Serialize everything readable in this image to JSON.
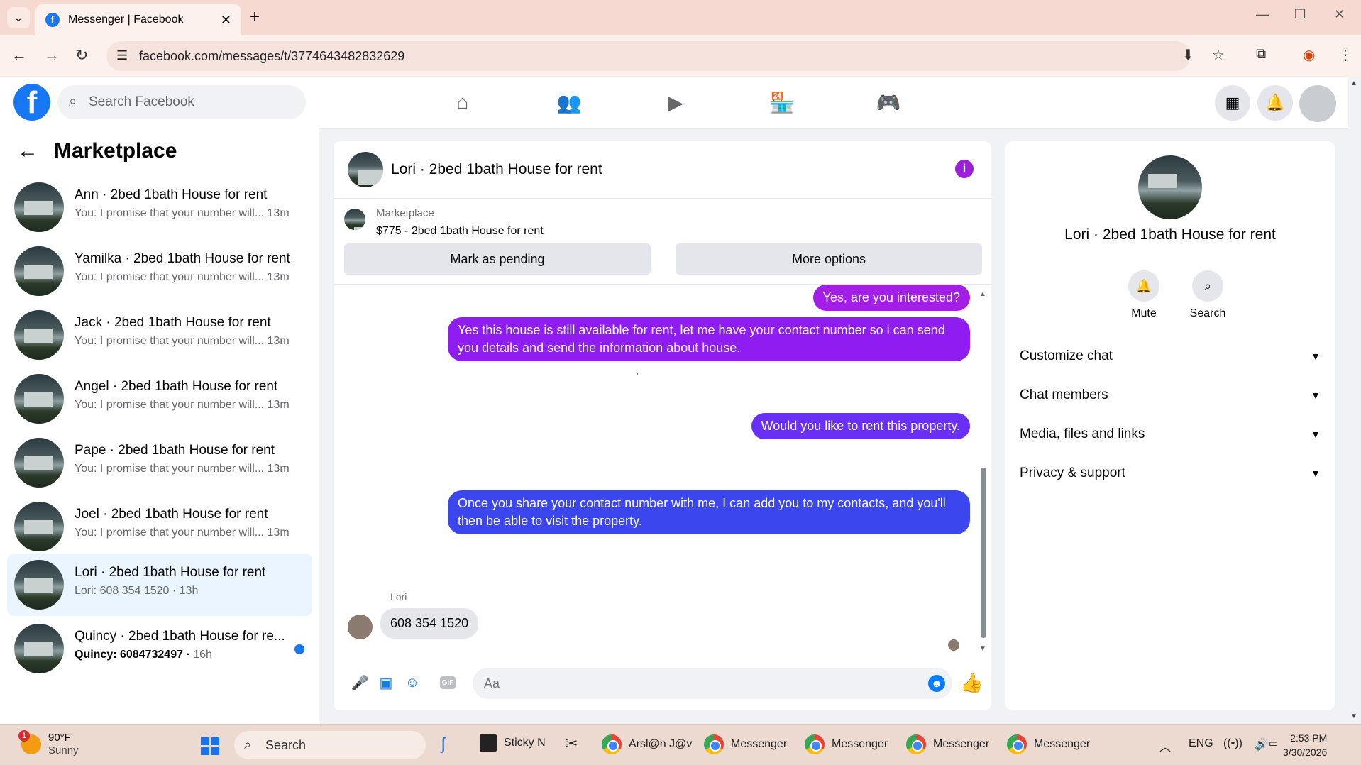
{
  "browser": {
    "tab_title": "Messenger | Facebook",
    "url": "facebook.com/messages/t/3774643482832629"
  },
  "fb": {
    "search_placeholder": "Search Facebook"
  },
  "left": {
    "title": "Marketplace",
    "conversations": [
      {
        "name": "Ann · 2bed 1bath House for rent",
        "preview": "You: I promise that your number will...",
        "time": "13m"
      },
      {
        "name": "Yamilka · 2bed 1bath House for rent",
        "preview": "You: I promise that your number will...",
        "time": "13m"
      },
      {
        "name": "Jack · 2bed 1bath House for rent",
        "preview": "You: I promise that your number will...",
        "time": "13m"
      },
      {
        "name": "Angel · 2bed 1bath House for rent",
        "preview": "You: I promise that your number will...",
        "time": "13m"
      },
      {
        "name": "Pape · 2bed 1bath House for rent",
        "preview": "You: I promise that your number will...",
        "time": "13m"
      },
      {
        "name": "Joel · 2bed 1bath House for rent",
        "preview": "You: I promise that your number will...",
        "time": "13m"
      },
      {
        "name": "Lori · 2bed 1bath House for rent",
        "preview": "Lori: 608 354 1520",
        "time": "13h"
      },
      {
        "name": "Quincy · 2bed 1bath House for re...",
        "preview": "Quincy: 6084732497",
        "time": "16h"
      }
    ]
  },
  "chat": {
    "title": "Lori · 2bed 1bath House for rent",
    "listing_label": "Marketplace",
    "listing_price": "$775 - 2bed 1bath House for rent",
    "mark_pending": "Mark as pending",
    "more_options": "More options",
    "messages": [
      "Yes, are you interested?",
      "Yes this house is still available for rent, let me have your contact number so i can send you details and send the information about house.",
      "Would you like to rent this property.",
      "Once you share your contact number with me, I can add you to my contacts, and you'll then be able to visit the property."
    ],
    "sender": "Lori",
    "received": "608 354 1520",
    "input_placeholder": "Aa",
    "gif_label": "GIF"
  },
  "right": {
    "name": "Lori · 2bed 1bath House for rent",
    "mute": "Mute",
    "search": "Search",
    "sections": [
      "Customize chat",
      "Chat members",
      "Media, files and links",
      "Privacy & support"
    ]
  },
  "taskbar": {
    "temp": "90°F",
    "condition": "Sunny",
    "weather_badge": "1",
    "search": "Search",
    "sticky": "Sticky N",
    "chrome1": "Arsl@n J@v",
    "messenger": "Messenger",
    "lang": "ENG",
    "time": "2:53 PM",
    "date": "3/30/2026"
  },
  "colors": {
    "fb_blue": "#1877f2",
    "bubble_purple": "#a31ee6",
    "bubble_blue": "#3b46ee",
    "active_row": "#ebf5ff"
  }
}
